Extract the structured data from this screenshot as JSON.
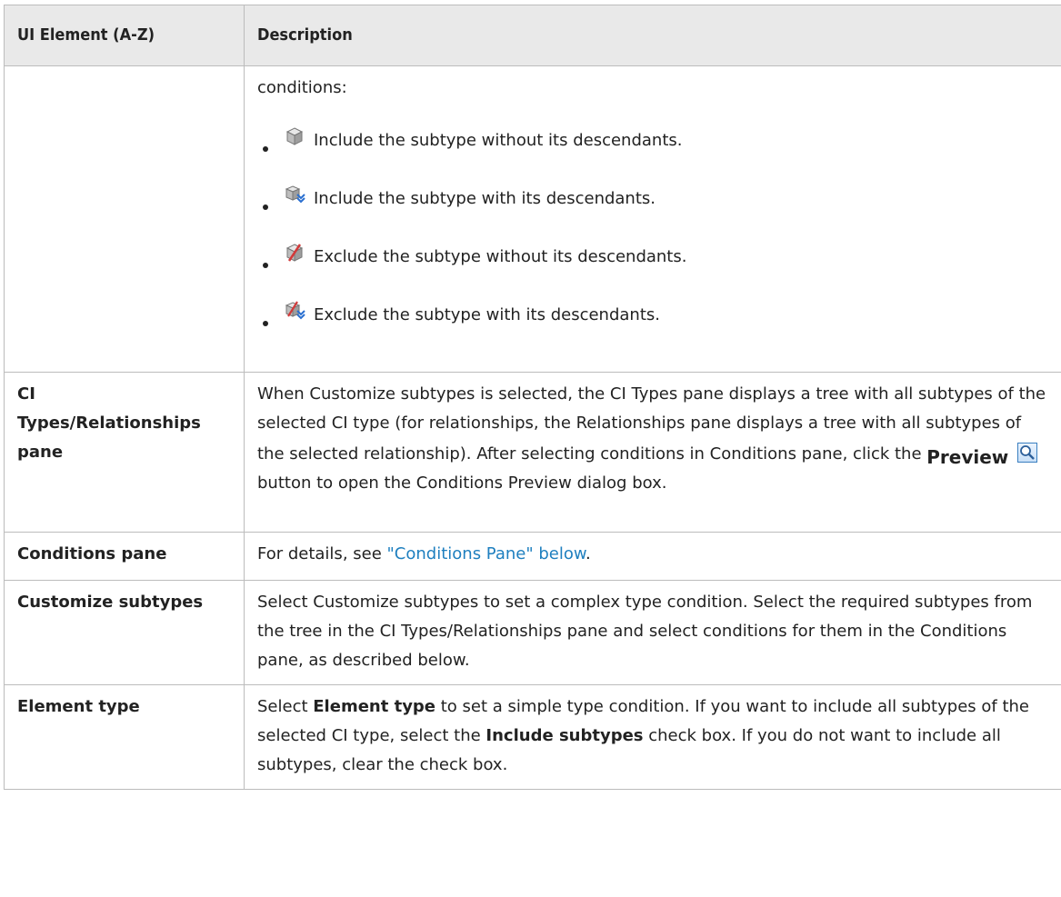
{
  "header": {
    "col1": "UI Element (A-Z)",
    "col2": "Description"
  },
  "rows": {
    "conditions_row": {
      "intro": "conditions:",
      "items": [
        {
          "icon": "cube-include-icon",
          "text": "Include the subtype without its descendants."
        },
        {
          "icon": "cube-include-descendants-icon",
          "text": "Include the subtype with its descendants."
        },
        {
          "icon": "cube-exclude-icon",
          "text": "Exclude the subtype without its descendants."
        },
        {
          "icon": "cube-exclude-descendants-icon",
          "text": "Exclude the subtype with its descendants."
        }
      ]
    },
    "ci_types": {
      "name_line1": "CI",
      "name_line2": "Types/Relationships",
      "name_line3": "pane",
      "desc_part1": "When Customize subtypes is selected, the CI Types pane displays a tree with all subtypes of the selected CI type (for relationships, the Relationships pane displays a tree with all subtypes of the selected relationship). After selecting conditions in Conditions pane, click the ",
      "preview_label": "Preview",
      "desc_part2": " button to open the Conditions Preview dialog box."
    },
    "conditions_pane": {
      "name": "Conditions pane",
      "desc_prefix": "For details, see ",
      "link": "\"Conditions Pane\" below",
      "desc_suffix": "."
    },
    "customize_subtypes": {
      "name": "Customize subtypes",
      "desc": "Select Customize subtypes to set a complex type condition. Select the required subtypes from the tree in the CI Types/Relationships pane and select conditions for them in the Conditions pane, as described below."
    },
    "element_type": {
      "name": "Element type",
      "desc_p1": "Select ",
      "desc_b1": "Element type",
      "desc_p2": " to set a simple type condition. If you want to include all subtypes of the selected CI type, select the ",
      "desc_b2": "Include subtypes",
      "desc_p3": " check box. If you do not want to include all subtypes, clear the check box."
    }
  },
  "colors": {
    "header_bg": "#e9e9e9",
    "border": "#bcbcbc",
    "link": "#1e7fbf"
  }
}
